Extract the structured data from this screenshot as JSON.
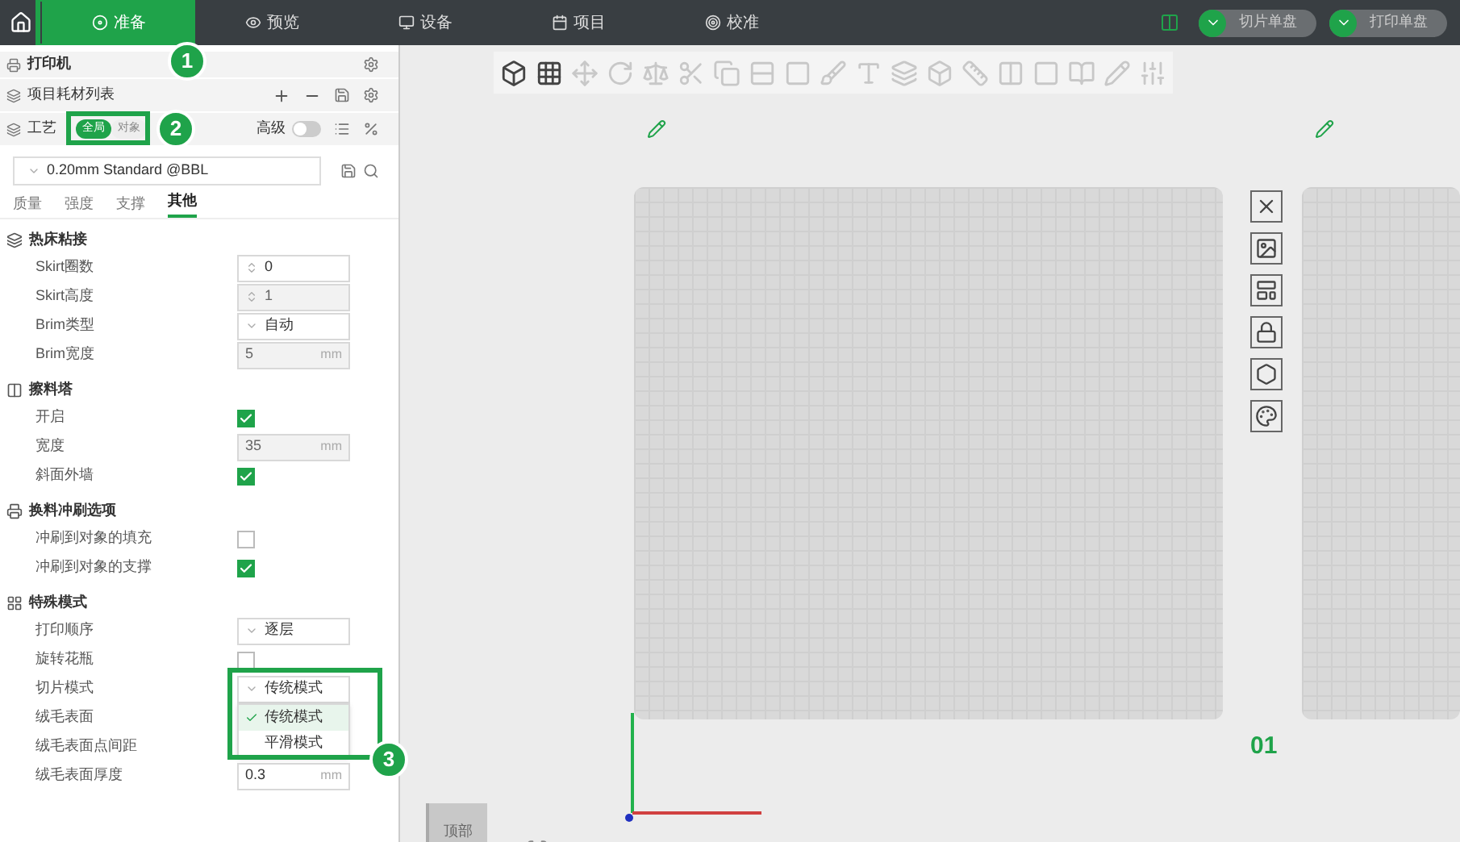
{
  "nav": {
    "tabs": [
      {
        "label": "准备",
        "selected": true
      },
      {
        "label": "预览",
        "selected": false
      },
      {
        "label": "设备",
        "selected": false
      },
      {
        "label": "项目",
        "selected": false
      },
      {
        "label": "校准",
        "selected": false
      }
    ]
  },
  "actions": [
    "切片单盘",
    "打印单盘"
  ],
  "sidebar": {
    "printer": "打印机",
    "filaments": "项目耗材列表",
    "process": {
      "label": "工艺",
      "modes": [
        {
          "label": "全局",
          "selected": true
        },
        {
          "label": "对象",
          "selected": false
        }
      ],
      "advanced": {
        "label": "高级",
        "on": false
      }
    },
    "preset": "0.20mm Standard @BBL",
    "tabs": [
      {
        "label": "质量",
        "selected": false
      },
      {
        "label": "强度",
        "selected": false
      },
      {
        "label": "支撑",
        "selected": false
      },
      {
        "label": "其他",
        "selected": true
      }
    ],
    "sections": [
      {
        "title": "热床粘接",
        "rows": [
          {
            "label": "Skirt圈数",
            "kind": "spin",
            "value": "0",
            "disabled": false
          },
          {
            "label": "Skirt高度",
            "kind": "spin",
            "value": "1",
            "disabled": true
          },
          {
            "label": "Brim类型",
            "kind": "combo",
            "value": "自动"
          },
          {
            "label": "Brim宽度",
            "kind": "unit",
            "value": "5",
            "unit": "mm",
            "disabled": true
          }
        ]
      },
      {
        "title": "擦料塔",
        "rows": [
          {
            "label": "开启",
            "kind": "check",
            "checked": true
          },
          {
            "label": "宽度",
            "kind": "unit",
            "value": "35",
            "unit": "mm",
            "disabled": true
          },
          {
            "label": "斜面外墙",
            "kind": "check",
            "checked": true
          }
        ]
      },
      {
        "title": "换料冲刷选项",
        "rows": [
          {
            "label": "冲刷到对象的填充",
            "kind": "check",
            "checked": false
          },
          {
            "label": "冲刷到对象的支撑",
            "kind": "check",
            "checked": true
          }
        ]
      },
      {
        "title": "特殊模式",
        "rows": [
          {
            "label": "打印顺序",
            "kind": "combo",
            "value": "逐层"
          },
          {
            "label": "旋转花瓶",
            "kind": "check",
            "checked": false
          },
          {
            "label": "切片模式",
            "kind": "dropdown",
            "value": "传统模式",
            "options": [
              {
                "label": "传统模式",
                "selected": true
              },
              {
                "label": "平滑模式",
                "selected": false
              }
            ]
          },
          {
            "label": "绒毛表面",
            "kind": "none"
          },
          {
            "label": "绒毛表面点间距",
            "kind": "none"
          },
          {
            "label": "绒毛表面厚度",
            "kind": "unit",
            "value": "0.3",
            "unit": "mm",
            "disabled": false
          }
        ]
      }
    ]
  },
  "callouts": [
    "1",
    "2",
    "3"
  ],
  "canvas": {
    "plate_number": "01",
    "view_cube": "顶部"
  }
}
